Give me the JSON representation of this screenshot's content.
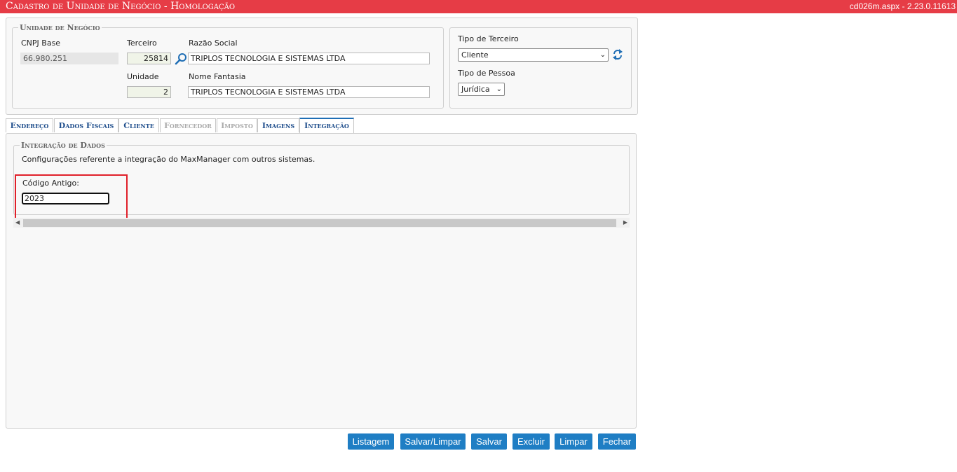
{
  "header": {
    "title": "Cadastro de Unidade de Negócio  - Homologação",
    "version": "cd026m.aspx - 2.23.0.11613"
  },
  "unidade": {
    "legend": "Unidade de Negócio",
    "cnpj_label": "CNPJ Base",
    "cnpj_value": "66.980.251",
    "terceiro_label": "Terceiro",
    "terceiro_value": "25814",
    "razao_label": "Razão Social",
    "razao_value": "TRIPLOS TECNOLOGIA E SISTEMAS LTDA",
    "unidade_label": "Unidade",
    "unidade_value": "2",
    "fantasia_label": "Nome Fantasia",
    "fantasia_value": "TRIPLOS TECNOLOGIA E SISTEMAS LTDA"
  },
  "tipo": {
    "terceiro_label": "Tipo de Terceiro",
    "terceiro_value": "Cliente",
    "pessoa_label": "Tipo de Pessoa",
    "pessoa_value": "Jurídica"
  },
  "tabs": [
    {
      "label": "Endereço",
      "state": "normal"
    },
    {
      "label": "Dados Fiscais",
      "state": "normal"
    },
    {
      "label": "Cliente",
      "state": "normal"
    },
    {
      "label": "Fornecedor",
      "state": "disabled"
    },
    {
      "label": "Imposto",
      "state": "disabled"
    },
    {
      "label": "Imagens",
      "state": "normal"
    },
    {
      "label": "Integração",
      "state": "active"
    }
  ],
  "integracao": {
    "legend": "Integração de Dados",
    "description": "Configurações referente a integração do MaxManager com outros sistemas.",
    "codigo_label": "Código Antigo:",
    "codigo_value": "2023"
  },
  "buttons": {
    "listagem": "Listagem",
    "salvar_limpar": "Salvar/Limpar",
    "salvar": "Salvar",
    "excluir": "Excluir",
    "limpar": "Limpar",
    "fechar": "Fechar"
  },
  "colors": {
    "header_bg": "#e63c46",
    "button_bg": "#1f7ec4",
    "tab_text": "#1f4e8c",
    "highlight": "#e0202a"
  }
}
